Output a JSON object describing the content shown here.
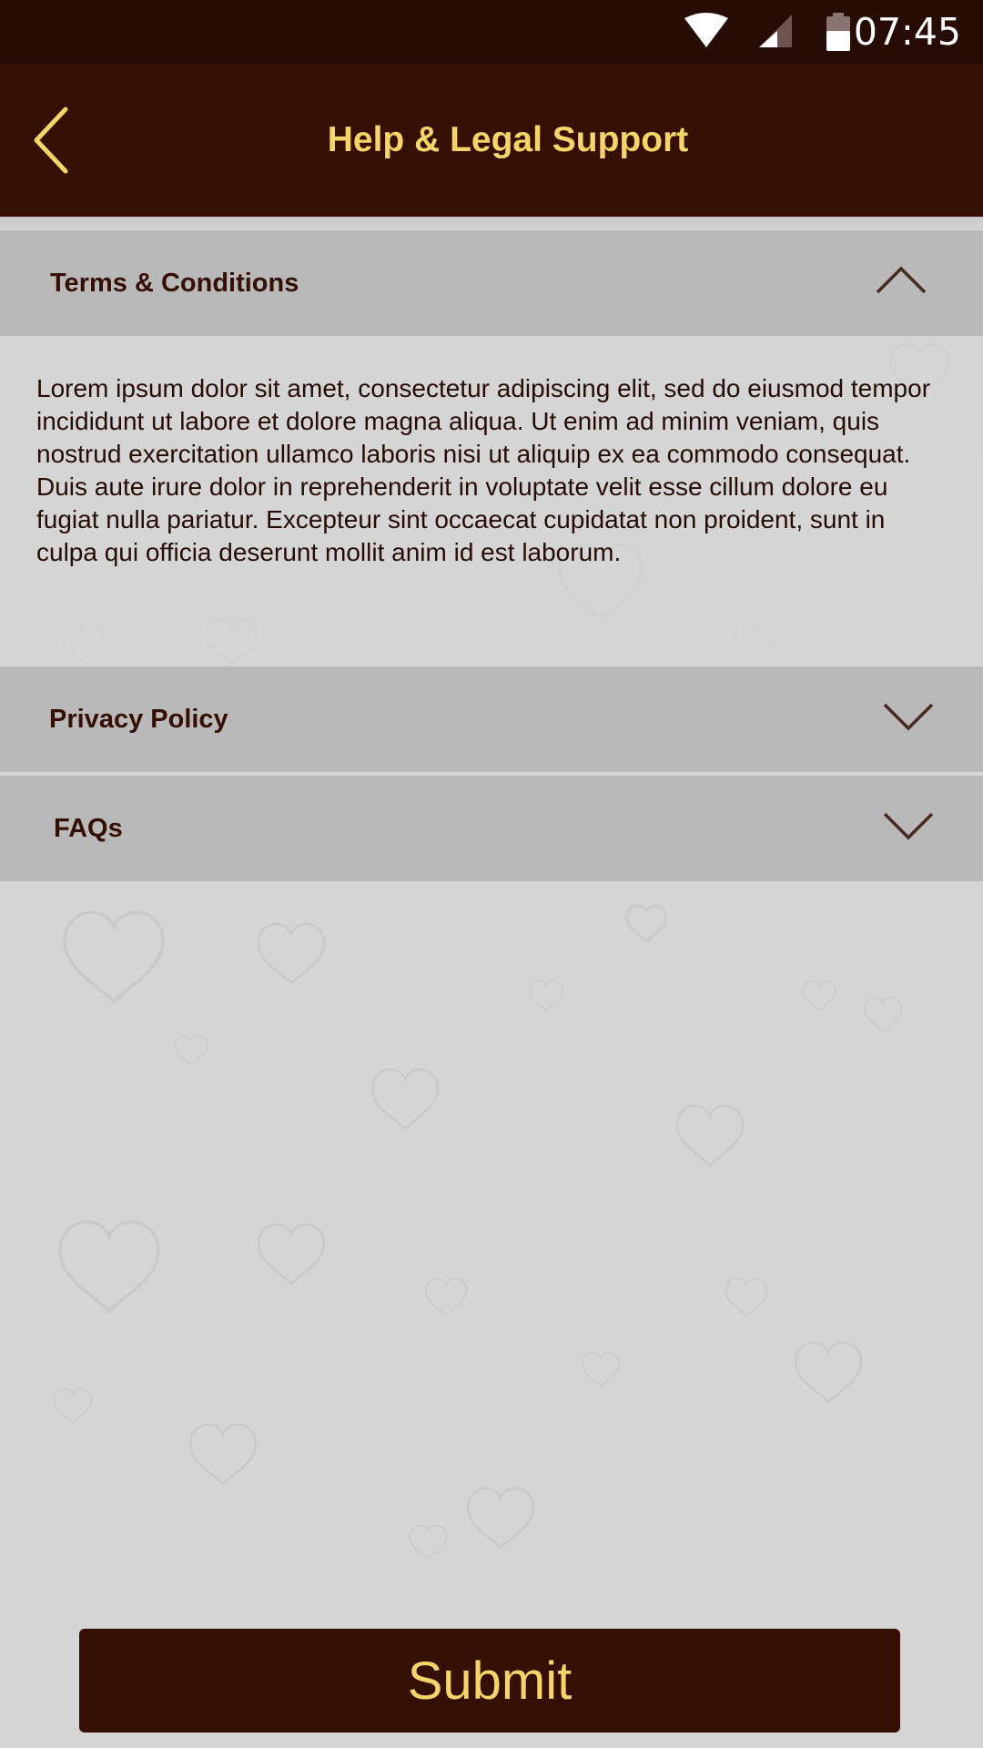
{
  "status_bar": {
    "time": "07:45",
    "icons": [
      "wifi-icon",
      "cell-signal-icon",
      "battery-icon"
    ]
  },
  "app_bar": {
    "title": "Help & Legal Support",
    "back_icon": "chevron-left-icon"
  },
  "sections": [
    {
      "title": "Terms & Conditions",
      "expanded": true,
      "body": "Lorem ipsum dolor sit amet, consectetur adipiscing elit, sed do eiusmod tempor incididunt ut labore et dolore magna aliqua. Ut enim ad minim veniam, quis nostrud exercitation ullamco laboris nisi ut aliquip ex ea commodo consequat. Duis aute irure dolor in reprehenderit in voluptate velit esse cillum dolore eu fugiat nulla pariatur. Excepteur sint occaecat cupidatat non proident, sunt in culpa qui officia deserunt mollit anim id est laborum."
    },
    {
      "title": "Privacy Policy",
      "expanded": false
    },
    {
      "title": "FAQs",
      "expanded": false
    }
  ],
  "submit_label": "Submit",
  "colors": {
    "status_bar": "#270c05",
    "app_bar": "#360f04",
    "accent": "#f5d46a",
    "header_bg": "#b9b9b9",
    "page_bg": "#d5d5d5",
    "text_dark": "#360f04"
  }
}
